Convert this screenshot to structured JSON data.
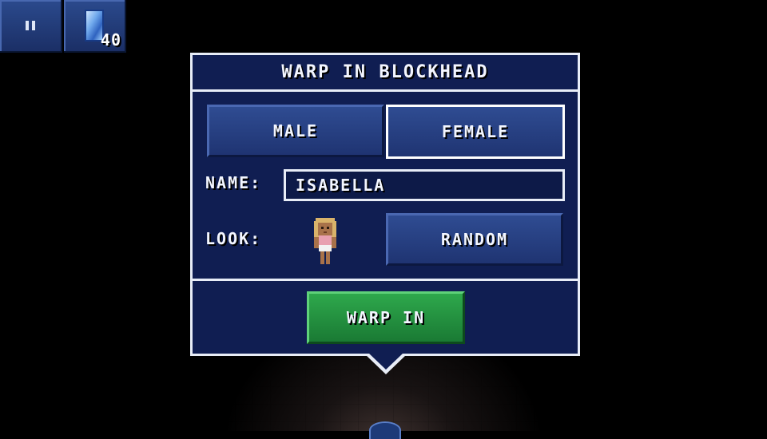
{
  "hud": {
    "pause_icon": "pause-icon",
    "crystal_icon": "time-crystal-icon",
    "crystal_count": "40"
  },
  "dialog": {
    "title": "WARP IN BLOCKHEAD",
    "gender_options": {
      "male": "MALE",
      "female": "FEMALE",
      "selected": "FEMALE"
    },
    "name_label": "NAME:",
    "name_value": "ISABELLA",
    "look_label": "LOOK:",
    "random_label": "RANDOM",
    "warp_in_label": "WARP IN"
  },
  "colors": {
    "panel": "#101e52",
    "border": "#e8edf7",
    "button_blue": "#2f4c92",
    "button_green": "#2ea84c"
  }
}
